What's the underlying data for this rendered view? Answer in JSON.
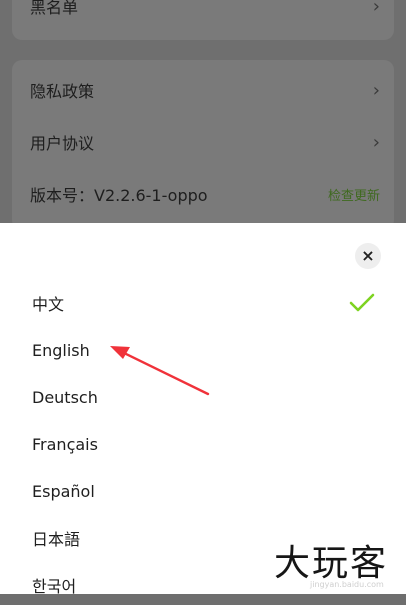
{
  "settings": {
    "rows": [
      {
        "label": "黑名单",
        "chevron": "›"
      },
      {
        "label": "隐私政策",
        "chevron": "›"
      },
      {
        "label": "用户协议",
        "chevron": "›"
      }
    ],
    "version_label": "版本号：V2.2.6-1-oppo",
    "check_update": "检查更新"
  },
  "language_sheet": {
    "close_symbol": "×",
    "languages": [
      "中文",
      "English",
      "Deutsch",
      "Français",
      "Español",
      "日本語",
      "한국어"
    ],
    "selected_language": "中文",
    "check_icon": "check-icon"
  },
  "watermark": {
    "main": "大玩客",
    "sub": "jingyan.baidu.com"
  },
  "colors": {
    "check": "#7ed321",
    "arrow": "#f0323a",
    "dim_overlay": "#6f6f6f",
    "sheet_bg": "#ffffff"
  }
}
